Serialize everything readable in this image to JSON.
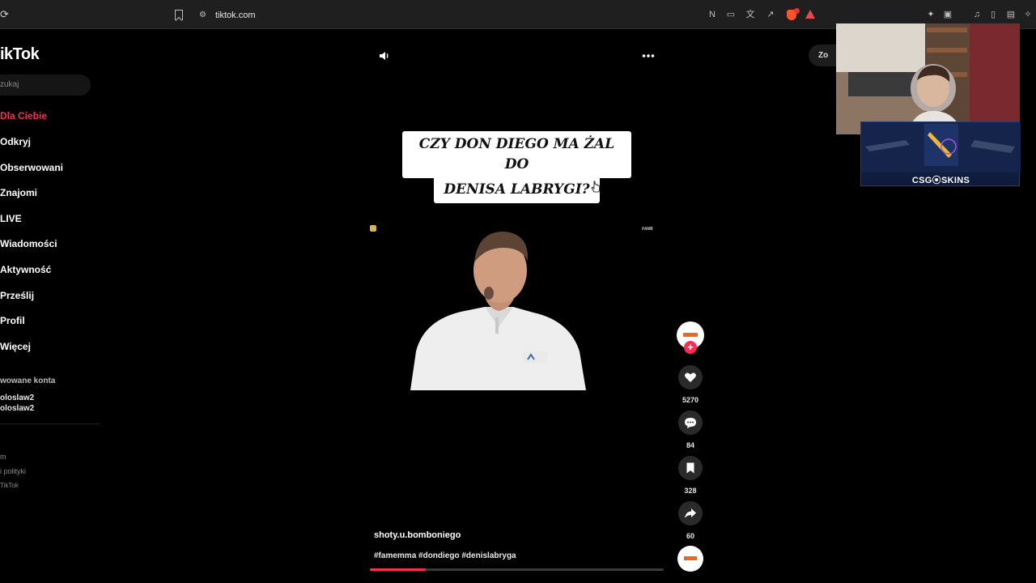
{
  "browser": {
    "url": "tiktok.com"
  },
  "sidebar": {
    "logo": "ikTok",
    "search_placeholder": "zukaj",
    "nav": [
      {
        "label": "Dla Ciebie",
        "active": true
      },
      {
        "label": "Odkryj"
      },
      {
        "label": "Obserwowani"
      },
      {
        "label": "Znajomi"
      },
      {
        "label": "LIVE"
      },
      {
        "label": "Wiadomości"
      },
      {
        "label": "Aktywność"
      },
      {
        "label": "Prześlij"
      },
      {
        "label": "Profil"
      },
      {
        "label": "Więcej"
      }
    ],
    "followed_accounts_label": "wowane konta",
    "accounts": [
      "oloslaw2",
      "oloslaw2"
    ],
    "footer": [
      "m",
      "i polityki",
      "TikTok"
    ]
  },
  "video": {
    "caption_line1": "CZY DON DIEGO MA ŻAL DO",
    "caption_line2": "DENISA LABRYGI?",
    "watermark_right": "FAME",
    "username": "shoty.u.bomboniego",
    "hashtags": "#famemma #dondiego #denislabryga",
    "progress": 0.19
  },
  "actions": {
    "likes": "5270",
    "comments": "84",
    "saves": "328",
    "shares": "60"
  },
  "zoom_label": "Zo",
  "sponsor": {
    "brand": "CSG⦿SKINS"
  },
  "colors": {
    "accent": "#fe2c55",
    "background": "#000000"
  }
}
